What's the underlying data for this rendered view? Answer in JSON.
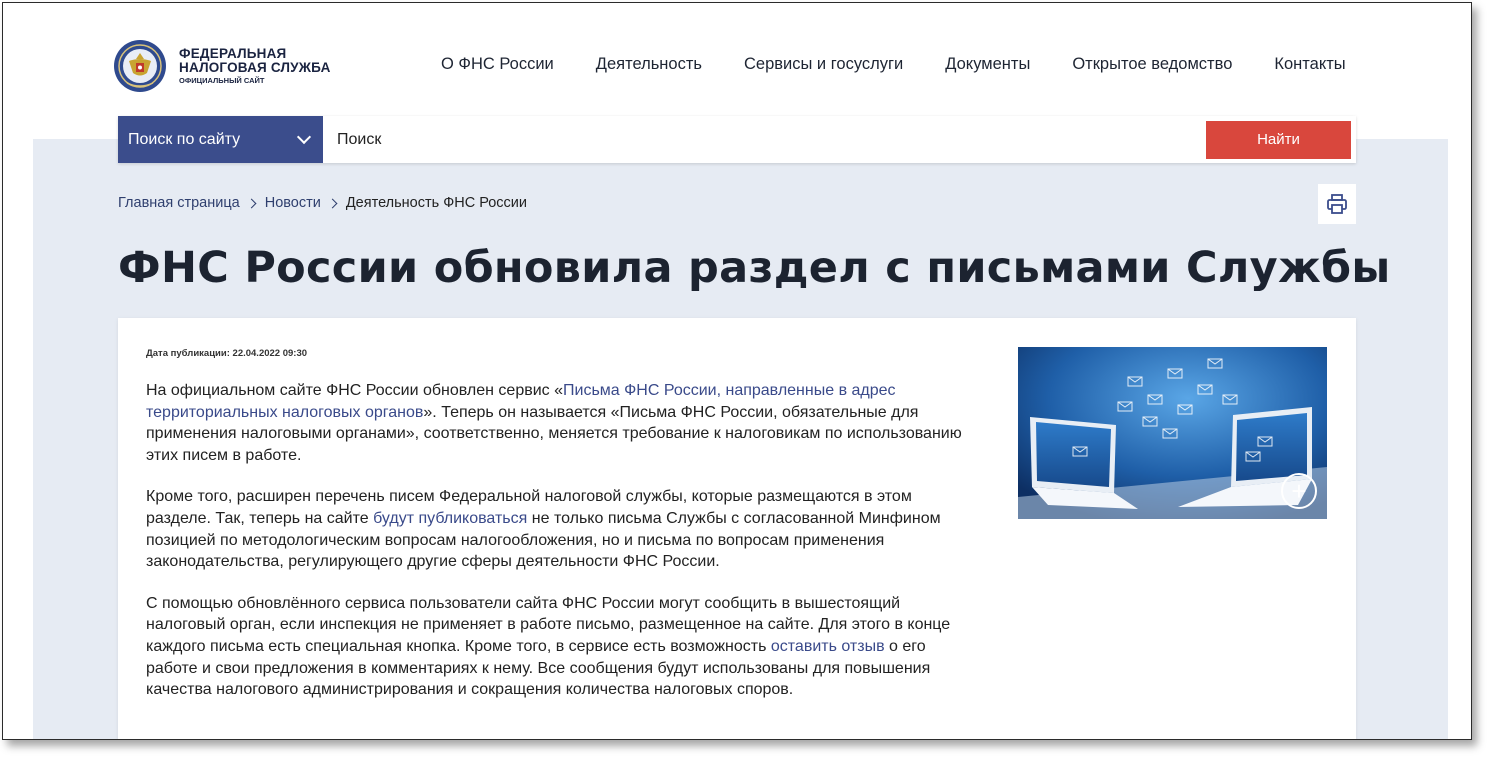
{
  "header": {
    "logo": {
      "line1": "ФЕДЕРАЛЬНАЯ",
      "line2": "НАЛОГОВАЯ СЛУЖБА",
      "line3": "ОФИЦИАЛЬНЫЙ САЙТ",
      "emblem_icon": "emblem-icon"
    },
    "nav": [
      {
        "label": "О ФНС России"
      },
      {
        "label": "Деятельность"
      },
      {
        "label": "Сервисы и госуслуги"
      },
      {
        "label": "Документы"
      },
      {
        "label": "Открытое ведомство"
      },
      {
        "label": "Контакты"
      }
    ]
  },
  "search": {
    "scope_label": "Поиск по сайту",
    "placeholder": "Поиск",
    "button_label": "Найти"
  },
  "breadcrumb": {
    "items": [
      {
        "label": "Главная страница"
      },
      {
        "label": "Новости"
      },
      {
        "label": "Деятельность ФНС России"
      }
    ]
  },
  "print_icon": "printer-icon",
  "article": {
    "title": "ФНС России обновила раздел с письмами Службы",
    "pubdate_label": "Дата публикации:",
    "pubdate_value": "22.04.2022 09:30",
    "p1_before": "На официальном сайте ФНС России обновлен сервис «",
    "p1_link": "Письма ФНС России, направленные в адрес территориальных налоговых органов",
    "p1_after": "». Теперь он называется «Письма ФНС России, обязательные для применения налоговыми органами», соответственно, меняется требование к налоговикам по использованию этих писем в работе.",
    "p2_before": "Кроме того, расширен перечень писем Федеральной налоговой службы, которые размещаются в этом разделе. Так, теперь на сайте ",
    "p2_link": "будут публиковаться",
    "p2_after": " не только письма Службы с согласованной Минфином позицией по методологическим вопросам налогообложения, но и письма по вопросам применения законодательства, регулирующего другие сферы деятельности ФНС России.",
    "p3_before": "С помощью обновлённого сервиса пользователи сайта ФНС России могут сообщить в вышестоящий налоговый орган, если инспекция не применяет в работе письмо, размещенное на сайте. Для этого в конце каждого письма есть специальная кнопка. Кроме того, в сервисе есть возможность ",
    "p3_link": "оставить отзыв",
    "p3_after": " о его работе и свои предложения в комментариях к нему. Все сообщения будут использованы для повышения качества налогового администрирования и сокращения количества налоговых споров.",
    "zoom_icon": "zoom-plus-icon"
  },
  "colors": {
    "accent_blue": "#3b4d8c",
    "search_button": "#d9473d",
    "content_background": "#e6ebf3",
    "link": "#3a4a8a"
  }
}
